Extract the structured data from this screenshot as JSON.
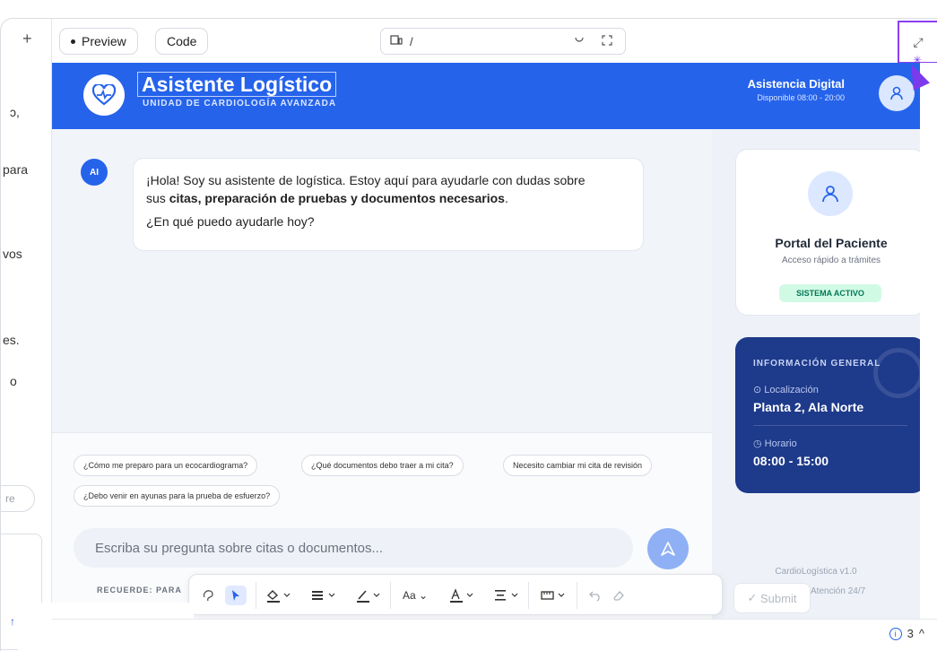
{
  "left_panel": {
    "plus": "+",
    "fragments": [
      "ɔ,",
      "para",
      "vos",
      "es.",
      "o"
    ],
    "pill_text": "re",
    "arrow": "↑"
  },
  "topbar": {
    "preview_label": "Preview",
    "code_label": "Code",
    "url_path": "/",
    "right_icon": "⤢"
  },
  "header": {
    "title": "Asistente Logístico",
    "subtitle": "UNIDAD DE CARDIOLOGÍA AVANZADA",
    "assist_title": "Asistencia Digital",
    "assist_hours": "Disponible 08:00 - 20:00"
  },
  "chat": {
    "ai_label": "AI",
    "line1": "¡Hola! Soy su asistente de logística. Estoy aquí para ayudarle con dudas sobre",
    "line2_pre": "sus ",
    "line2_bold": "citas, preparación de pruebas y documentos necesarios",
    "line2_post": ".",
    "line3": "¿En qué puedo ayudarle hoy?"
  },
  "suggestions": [
    "¿Cómo me preparo para un ecocardiograma?",
    "¿Qué documentos debo traer a mi cita?",
    "Necesito cambiar mi cita de revisión",
    "¿Debo venir en ayunas para la prueba de esfuerzo?"
  ],
  "input": {
    "placeholder": "Escriba su pregunta sobre citas o documentos..."
  },
  "reminder_text": "RECUERDE: PARA",
  "sidebar": {
    "portal_title": "Portal del Paciente",
    "portal_sub": "Acceso rápido a trámites",
    "status": "SISTEMA ACTIVO",
    "info_title": "INFORMACIÓN GENERAL",
    "loc_label": "Localización",
    "loc_value": "Planta 2, Ala Norte",
    "hours_label": "Horario",
    "hours_value": "08:00 - 15:00",
    "version": "CardioLogística v1.0",
    "attention": "Atención 24/7"
  },
  "toolbar": {
    "font_label": "Aa",
    "submit_label": "Submit"
  },
  "status_bar": {
    "issues_count": "3"
  },
  "colors": {
    "brand_blue": "#2563eb",
    "navy": "#1e3a8a",
    "accent_purple": "#8a3ff0",
    "status_green": "#047857"
  }
}
